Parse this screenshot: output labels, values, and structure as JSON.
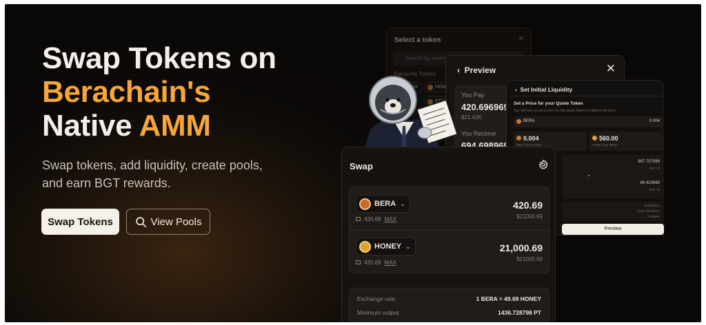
{
  "hero": {
    "headline_line1": "Swap Tokens on",
    "headline_accent": "Berachain's",
    "headline_line3_a": "Native ",
    "headline_line3_b": "AMM",
    "subtitle": "Swap tokens, add liquidity, create pools, and earn BGT rewards.",
    "primary_button": "Swap Tokens",
    "secondary_button": "View Pools",
    "accent_color": "#f7a63a"
  },
  "token_panel": {
    "title": "Select a token",
    "search_placeholder": "Search by name or address",
    "favourites_label": "Favourite Tokens",
    "chips": [
      "BERA",
      "HONEY",
      "ETH"
    ]
  },
  "preview_panel": {
    "title": "Preview",
    "you_pay_label": "You Pay",
    "you_pay_value": "420.696969",
    "you_pay_usd": "$21.42K",
    "you_receive_label": "You Receive",
    "you_receive_value": "694.698969"
  },
  "liquidity_panel": {
    "title": "Set Initial Liquidity",
    "set_price_label": "Set a Price for your Quote Token",
    "hint": "You will have to set a price for this quote token to initialize the pool.",
    "row_token": "BERA",
    "row_value": "0.004",
    "box1_value": "0.004",
    "box1_label": "BERA per HONEY",
    "box2_value": "560.00",
    "box2_label": "HONEY per BERA",
    "amount1": "867.757569",
    "amount1_sub": "BGT 75",
    "amount2": "69.420669",
    "amount2_sub": "BGT 75",
    "summary1": "BATE/BGT",
    "summary2": "1436.728798 PT",
    "summary3": "0.0000%",
    "preview_button": "Preview"
  },
  "swap_panel": {
    "title": "Swap",
    "from_token": "BERA",
    "from_balance": "420.69",
    "from_max": "MAX",
    "from_amount": "420.69",
    "from_usd": "$21000.69",
    "to_token": "HONEY",
    "to_balance": "420.69",
    "to_max": "MAX",
    "to_amount": "21,000.69",
    "to_usd": "$21000.69",
    "exchange_rate_label": "Exchange rate",
    "exchange_rate_value": "1 BERA = 49.69 HONEY",
    "min_output_label": "Minimum output",
    "min_output_value": "1436.728798 PT"
  }
}
